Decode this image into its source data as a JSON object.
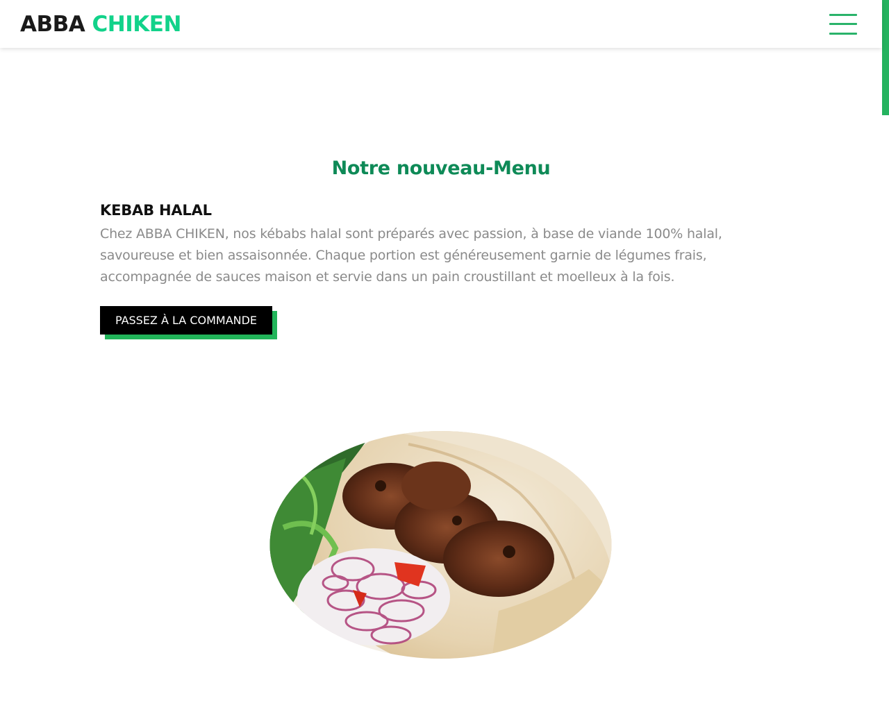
{
  "navbar": {
    "brand_primary": "ABBA",
    "brand_accent": "CHIKEN",
    "menu_icon": "hamburger-menu-icon",
    "colors": {
      "brand_accent": "#12d28a",
      "menu_icon": "#2ab36a",
      "scrollbar": "#25b35f"
    }
  },
  "menu_section": {
    "title": "Notre nouveau-Menu",
    "item": {
      "name": "KEBAB HALAL",
      "description": "Chez ABBA CHIKEN, nos kébabs halal sont préparés avec passion, à base de viande 100% halal, savoureuse et bien assaisonnée. Chaque portion est généreusement garnie de légumes frais, accompagnée de sauces maison et servie dans un pain croustillant et moelleux à la fois.",
      "cta_label": "PASSEZ À LA COMMANDE",
      "image_icon": "kebab-dish-photo"
    },
    "colors": {
      "title": "#0e8a57",
      "cta_bg": "#000000",
      "cta_shadow": "#22b55a"
    }
  }
}
